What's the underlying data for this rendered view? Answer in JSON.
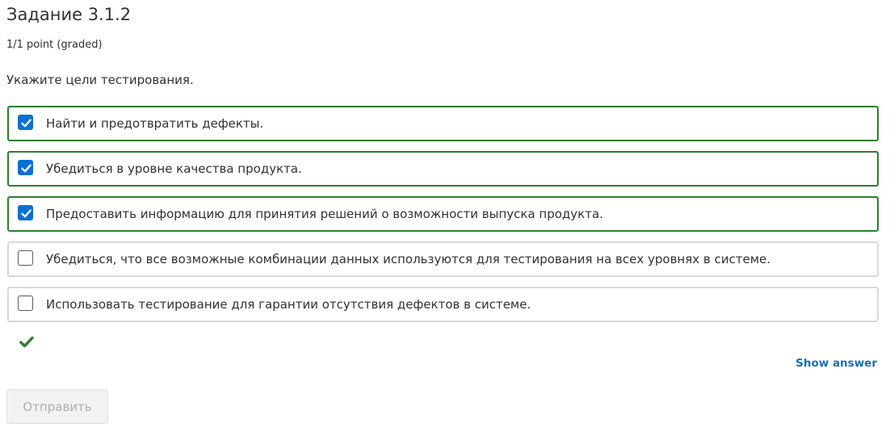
{
  "problem": {
    "title": "Задание 3.1.2",
    "grade": "1/1 point (graded)",
    "prompt": "Укажите цели тестирования."
  },
  "choices": [
    {
      "label": "Найти и предотвратить дефекты.",
      "checked": true,
      "correct": true
    },
    {
      "label": "Убедиться в уровне качества продукта.",
      "checked": true,
      "correct": true
    },
    {
      "label": "Предоставить информацию для принятия решений о возможности выпуска продукта.",
      "checked": true,
      "correct": true
    },
    {
      "label": "Убедиться, что все возможные комбинации данных используются для тестирования на всех уровнях в системе.",
      "checked": false,
      "correct": false
    },
    {
      "label": "Использовать тестирование для гарантии отсутствия дефектов в системе.",
      "checked": false,
      "correct": false
    }
  ],
  "status": {
    "icon": "checkmark-icon",
    "state": "correct",
    "color": "#2e7d32"
  },
  "actions": {
    "show_answer_label": "Show answer",
    "submit_label": "Отправить",
    "submit_enabled": false
  },
  "colors": {
    "correct_border": "#2e7d32",
    "neutral_border": "#d9d9d9",
    "checkbox_checked": "#0a6fd6",
    "link": "#1b6ea8"
  }
}
